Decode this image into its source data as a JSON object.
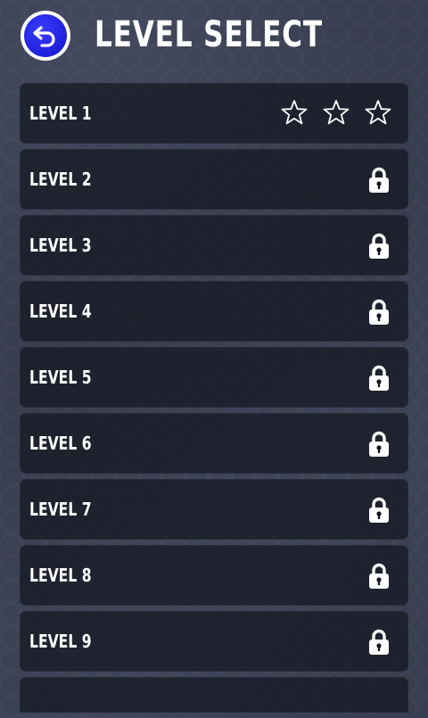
{
  "header": {
    "title": "LEVEL SELECT",
    "back_icon": "back-arrow-icon"
  },
  "levels": [
    {
      "label": "LEVEL 1",
      "locked": false,
      "stars_earned": 0,
      "stars_total": 3
    },
    {
      "label": "LEVEL 2",
      "locked": true
    },
    {
      "label": "LEVEL 3",
      "locked": true
    },
    {
      "label": "LEVEL 4",
      "locked": true
    },
    {
      "label": "LEVEL 5",
      "locked": true
    },
    {
      "label": "LEVEL 6",
      "locked": true
    },
    {
      "label": "LEVEL 7",
      "locked": true
    },
    {
      "label": "LEVEL 8",
      "locked": true
    },
    {
      "label": "LEVEL 9",
      "locked": true
    }
  ],
  "colors": {
    "background": "#383d4f",
    "row": "#14161f",
    "back_button": "#2b2cf0",
    "text": "#ffffff"
  }
}
